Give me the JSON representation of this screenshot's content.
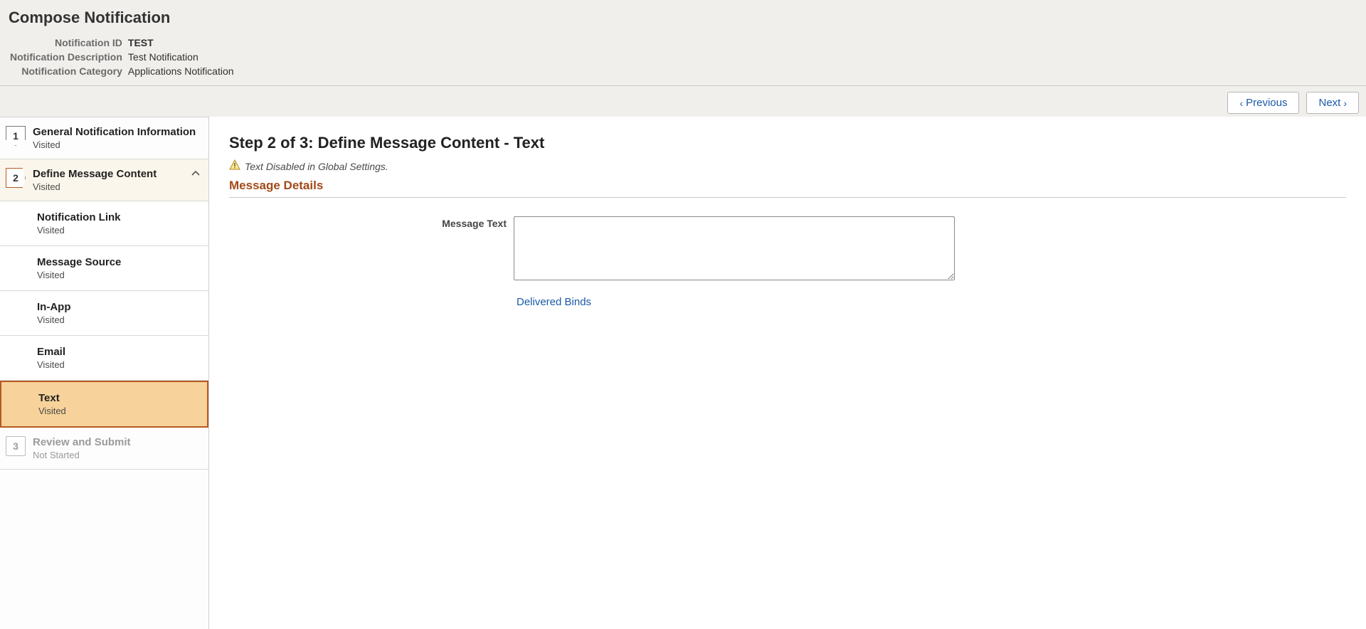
{
  "page": {
    "title": "Compose Notification"
  },
  "meta": {
    "notification_id_label": "Notification ID",
    "notification_id_value": "TEST",
    "notification_description_label": "Notification Description",
    "notification_description_value": "Test Notification",
    "notification_category_label": "Notification Category",
    "notification_category_value": "Applications Notification"
  },
  "nav": {
    "previous_label": "Previous",
    "next_label": "Next"
  },
  "sidebar": {
    "step1": {
      "num": "1",
      "title": "General Notification Information",
      "status": "Visited"
    },
    "step2": {
      "num": "2",
      "title": "Define Message Content",
      "status": "Visited"
    },
    "subs": [
      {
        "title": "Notification Link",
        "status": "Visited"
      },
      {
        "title": "Message Source",
        "status": "Visited"
      },
      {
        "title": "In-App",
        "status": "Visited"
      },
      {
        "title": "Email",
        "status": "Visited"
      },
      {
        "title": "Text",
        "status": "Visited"
      }
    ],
    "step3": {
      "num": "3",
      "title": "Review and Submit",
      "status": "Not Started"
    }
  },
  "content": {
    "heading": "Step 2 of 3: Define Message Content - Text",
    "warning_text": "Text Disabled in Global Settings.",
    "section_title": "Message Details",
    "message_text_label": "Message Text",
    "message_text_value": "",
    "delivered_binds_label": "Delivered Binds"
  }
}
